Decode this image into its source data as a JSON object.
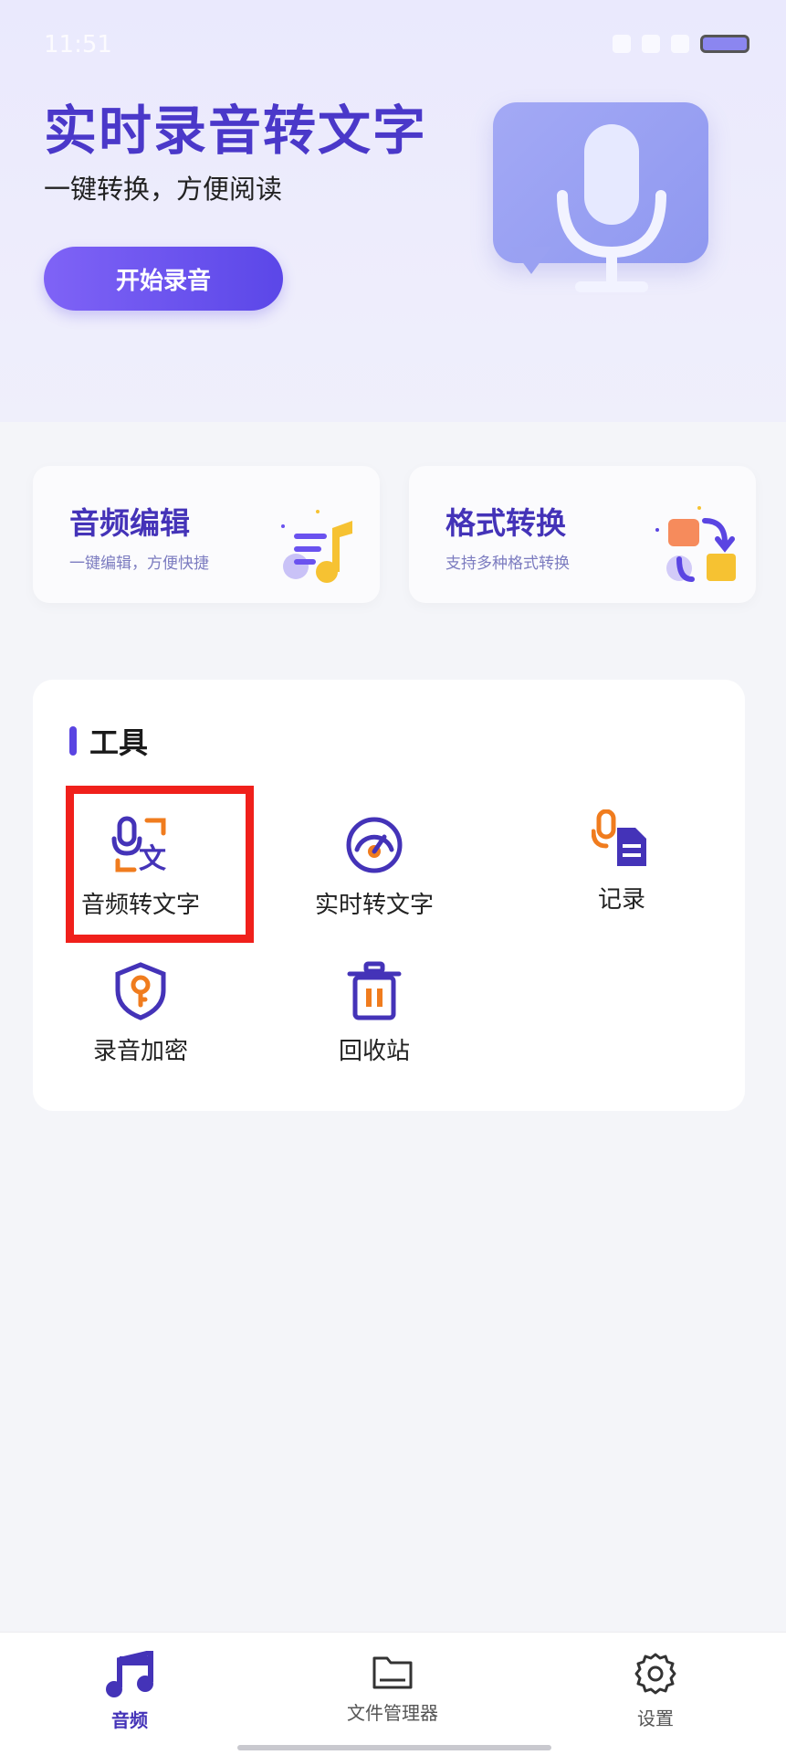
{
  "status": {
    "time": "11:51"
  },
  "hero": {
    "title": "实时录音转文字",
    "subtitle": "一键转换，方便阅读",
    "start_button": "开始录音"
  },
  "features": [
    {
      "title": "音频编辑",
      "subtitle": "一键编辑，方便快捷",
      "icon": "music-notes-art"
    },
    {
      "title": "格式转换",
      "subtitle": "支持多种格式转换",
      "icon": "format-convert-art"
    }
  ],
  "tools": {
    "title": "工具",
    "items": [
      {
        "label": "音频转文字",
        "icon": "mic-translate-icon"
      },
      {
        "label": "实时转文字",
        "icon": "speedometer-icon"
      },
      {
        "label": "记录",
        "icon": "mic-document-icon"
      },
      {
        "label": "录音加密",
        "icon": "shield-key-icon"
      },
      {
        "label": "回收站",
        "icon": "trash-icon"
      }
    ]
  },
  "tabbar": {
    "items": [
      {
        "label": "音频",
        "icon": "music-note-icon",
        "active": true
      },
      {
        "label": "文件管理器",
        "icon": "folder-icon",
        "active": false
      },
      {
        "label": "设置",
        "icon": "gear-icon",
        "active": false
      }
    ]
  },
  "colors": {
    "accent": "#4433b8",
    "primary_button": "#6a52ef",
    "highlight_box": "#f0201b"
  }
}
